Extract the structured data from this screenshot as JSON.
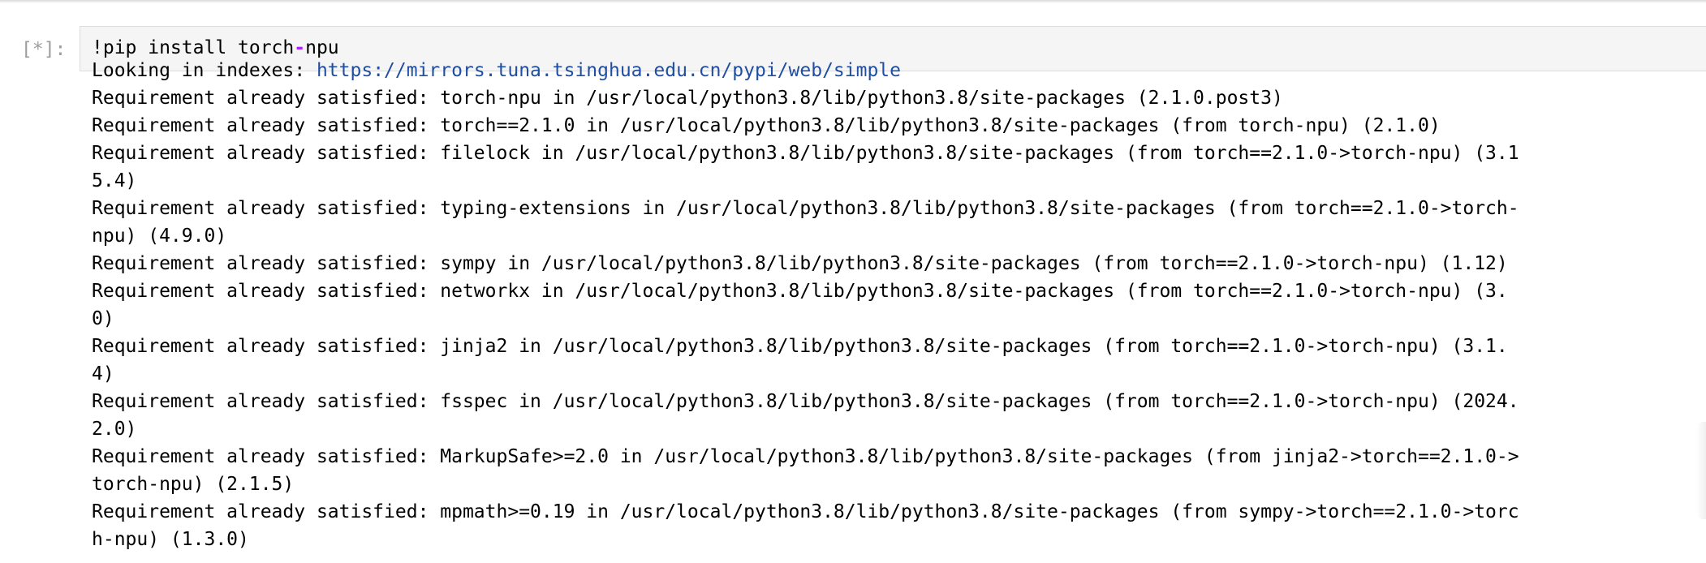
{
  "cell": {
    "prompt": "[*]:",
    "input": {
      "part1": "!pip install torch",
      "operator": "-",
      "part2": "npu"
    }
  },
  "output": {
    "index_prefix": "Looking in indexes: ",
    "index_url": "https://mirrors.tuna.tsinghua.edu.cn/pypi/web/simple",
    "lines": [
      "Requirement already satisfied: torch-npu in /usr/local/python3.8/lib/python3.8/site-packages (2.1.0.post3)",
      "Requirement already satisfied: torch==2.1.0 in /usr/local/python3.8/lib/python3.8/site-packages (from torch-npu) (2.1.0)",
      "Requirement already satisfied: filelock in /usr/local/python3.8/lib/python3.8/site-packages (from torch==2.1.0->torch-npu) (3.1",
      "5.4)",
      "Requirement already satisfied: typing-extensions in /usr/local/python3.8/lib/python3.8/site-packages (from torch==2.1.0->torch-",
      "npu) (4.9.0)",
      "Requirement already satisfied: sympy in /usr/local/python3.8/lib/python3.8/site-packages (from torch==2.1.0->torch-npu) (1.12)",
      "Requirement already satisfied: networkx in /usr/local/python3.8/lib/python3.8/site-packages (from torch==2.1.0->torch-npu) (3.",
      "0)",
      "Requirement already satisfied: jinja2 in /usr/local/python3.8/lib/python3.8/site-packages (from torch==2.1.0->torch-npu) (3.1.",
      "4)",
      "Requirement already satisfied: fsspec in /usr/local/python3.8/lib/python3.8/site-packages (from torch==2.1.0->torch-npu) (2024.",
      "2.0)",
      "Requirement already satisfied: MarkupSafe>=2.0 in /usr/local/python3.8/lib/python3.8/site-packages (from jinja2->torch==2.1.0->",
      "torch-npu) (2.1.5)",
      "Requirement already satisfied: mpmath>=0.19 in /usr/local/python3.8/lib/python3.8/site-packages (from sympy->torch==2.1.0->torc",
      "h-npu) (1.3.0)"
    ]
  }
}
